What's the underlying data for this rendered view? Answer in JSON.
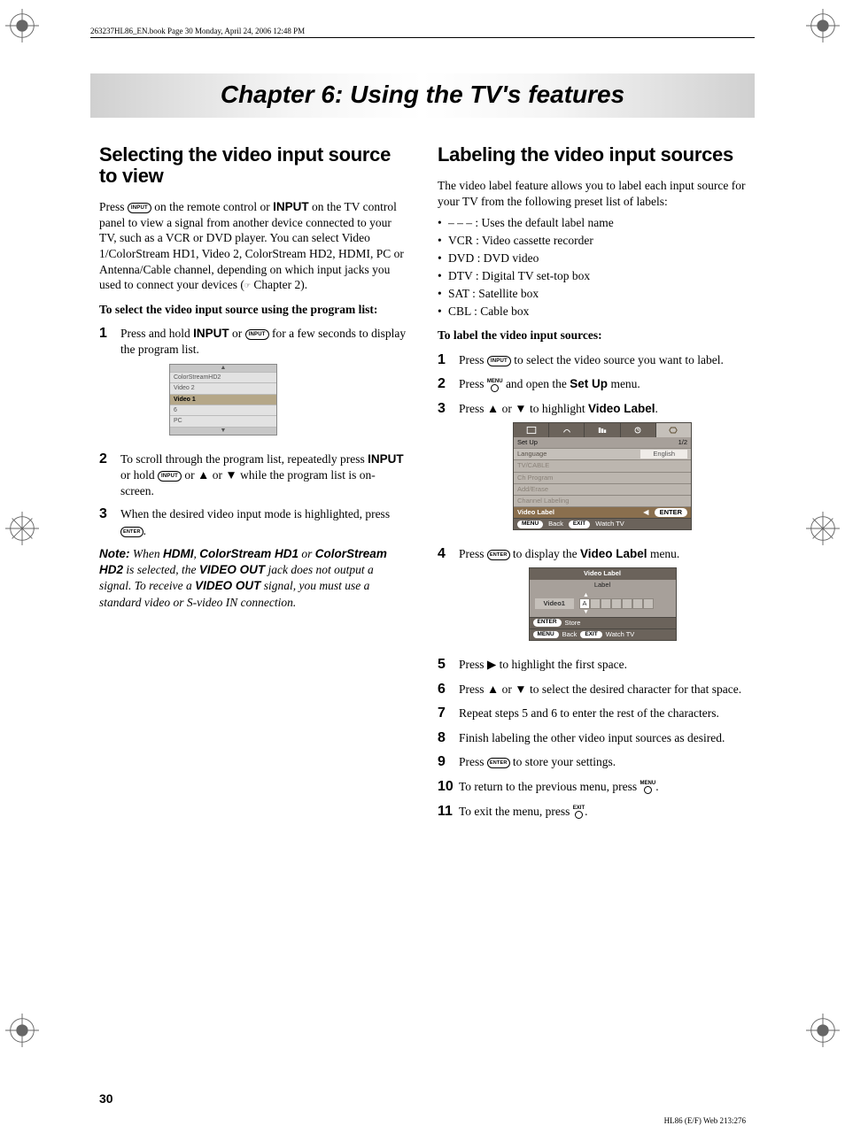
{
  "header_line": "263237HL86_EN.book  Page 30  Monday, April 24, 2006  12:48 PM",
  "chapter_title": "Chapter 6: Using the TV's features",
  "left": {
    "heading": "Selecting the video input source to view",
    "intro_1a": "Press ",
    "intro_1b": " on the remote control or ",
    "intro_1c": " on the TV control panel to view a signal from another device connected to your TV, such as a VCR or DVD player. You can select Video 1/ColorStream HD1, Video 2, ColorStream HD2, HDMI, PC or Antenna/Cable channel, depending on which input jacks you used to connect your devices (",
    "intro_1d": " Chapter 2).",
    "subhead": "To select the video input source using the program list:",
    "step1_a": "Press and hold ",
    "step1_b": " or ",
    "step1_c": " for a few seconds to display the program list.",
    "prog_list": {
      "r0": "▲",
      "r1": "ColorStreamHD2",
      "r2": "Video 2",
      "r3": "Video 1",
      "r4": "6",
      "r5": "PC",
      "r6": "▼"
    },
    "step2_a": "To scroll through the program list, repeatedly press ",
    "step2_b": " or hold ",
    "step2_c": " or ▲ or ▼ while the program list is on-screen.",
    "step3_a": "When the desired video input mode is highlighted, press ",
    "step3_b": ".",
    "note_label": "Note:",
    "note_a": " When ",
    "note_b": ", ",
    "note_c": " or ",
    "note_d": " is selected, the ",
    "note_e": " jack does not output a signal. To receive a ",
    "note_f": " signal, you must use a standard video or S-video IN connection.",
    "note_terms": {
      "hdmi": "HDMI",
      "cs1": "ColorStream HD1",
      "cs2": "ColorStream HD2",
      "vout": "VIDEO OUT"
    }
  },
  "right": {
    "heading": "Labeling the video input sources",
    "intro": "The video label feature allows you to label each input source for your TV from the following preset list of labels:",
    "labels": [
      "– – – : Uses the default label name",
      "VCR : Video cassette recorder",
      "DVD : DVD video",
      "DTV : Digital TV set-top box",
      "SAT : Satellite box",
      "CBL : Cable box"
    ],
    "subhead": "To label the video input sources:",
    "s1_a": "Press ",
    "s1_b": " to select the video source you want to label.",
    "s2_a": "Press ",
    "s2_b": " and open the ",
    "s2_c": " menu.",
    "s3_a": "Press ▲ or ▼ to highlight ",
    "s3_b": ".",
    "setup_menu": {
      "title": "Set Up",
      "page": "1/2",
      "rows": [
        {
          "l": "Language",
          "r": "English"
        },
        {
          "l": "TV/CABLE",
          "r": ""
        },
        {
          "l": "Ch Program",
          "r": ""
        },
        {
          "l": "Add/Erase",
          "r": ""
        },
        {
          "l": "Channel Labeling",
          "r": ""
        },
        {
          "l": "Video Label",
          "r": "",
          "sel": true,
          "enter": true
        }
      ],
      "foot": {
        "menu": "MENU",
        "back": "Back",
        "exit": "EXIT",
        "watch": "Watch TV"
      }
    },
    "s4_a": "Press ",
    "s4_b": " to display the ",
    "s4_c": " menu.",
    "vlabel_menu": {
      "title": "Video Label",
      "head": "Label",
      "src": "Video1",
      "char": "A",
      "foot": {
        "enter": "ENTER",
        "store": "Store",
        "menu": "MENU",
        "back": "Back",
        "exit": "EXIT",
        "watch": "Watch TV"
      }
    },
    "s5": "Press ▶ to highlight the first space.",
    "s6": "Press ▲ or ▼ to select the desired character for that space.",
    "s7": "Repeat steps 5 and 6 to enter the rest of the characters.",
    "s8": "Finish labeling the other video input sources as desired.",
    "s9_a": "Press ",
    "s9_b": " to store your settings.",
    "s10_a": "To return to the previous menu, press ",
    "s10_b": ".",
    "s11_a": "To exit the menu, press ",
    "s11_b": "."
  },
  "btn": {
    "input": "INPUT",
    "enter": "ENTER",
    "menu": "MENU",
    "exit": "EXIT",
    "setup": "Set Up",
    "vlabel": "Video Label"
  },
  "page_number": "30",
  "footer_right": "HL86 (E/F) Web 213:276"
}
